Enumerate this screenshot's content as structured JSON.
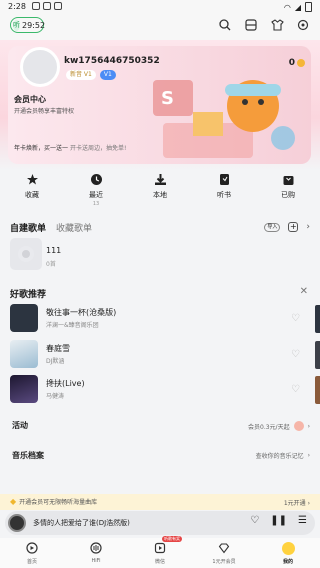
{
  "status_bar": {
    "time": "2:28"
  },
  "top_bar": {
    "timer": "29:52"
  },
  "profile": {
    "username": "kw1756446750352",
    "badge_level": "新音 V1",
    "badge_blue": "V1",
    "coins": "0",
    "vip_title": "会员中心",
    "vip_sub": "开通会员畅享丰富特权",
    "vip_promo": "年卡焕新，买一送一",
    "vip_promo_more": "开卡送周边，抽免单!"
  },
  "shortcuts": [
    {
      "label": "收藏",
      "count": "",
      "icon": "star-icon"
    },
    {
      "label": "最近",
      "count": "13",
      "icon": "clock-icon"
    },
    {
      "label": "本地",
      "count": "",
      "icon": "download-icon"
    },
    {
      "label": "听书",
      "count": "",
      "icon": "book-icon"
    },
    {
      "label": "已购",
      "count": "",
      "icon": "bag-icon"
    }
  ],
  "playlists": {
    "tab_active": "自建歌单",
    "tab_inactive": "收藏歌单",
    "import_label": "导入",
    "items": [
      {
        "name": "111",
        "count": "0首"
      }
    ]
  },
  "recommend": {
    "title": "好歌推荐",
    "songs": [
      {
        "title": "敬往事一杯(沧桑版)",
        "artist": "洋澜一&臻音阁乐团",
        "color": "#2c3440"
      },
      {
        "title": "春庭雪",
        "artist": "DJ默涵",
        "color": "#b7d2e4"
      },
      {
        "title": "搀扶(Live)",
        "artist": "马健涛",
        "color": "#3a2f55"
      }
    ]
  },
  "activity": {
    "label": "活动",
    "right": "会员0.3元/天起"
  },
  "music_archive": {
    "label": "音乐档案",
    "right": "查收你的音乐记忆"
  },
  "vip_banner": {
    "text": "开通会员可无限畅听海量曲库",
    "cta": "1元开通"
  },
  "player": {
    "title": "多情的人把爱给了谁(DJ浩然版)"
  },
  "tabbar": [
    {
      "label": "首页",
      "icon": "home-icon",
      "tag": ""
    },
    {
      "label": "HiFi",
      "icon": "hifi-icon",
      "tag": ""
    },
    {
      "label": "微信",
      "icon": "video-icon",
      "tag": "听歌有奖"
    },
    {
      "label": "1元开会员",
      "icon": "diamond-icon",
      "tag": ""
    },
    {
      "label": "我的",
      "icon": "mine-icon",
      "tag": ""
    }
  ]
}
